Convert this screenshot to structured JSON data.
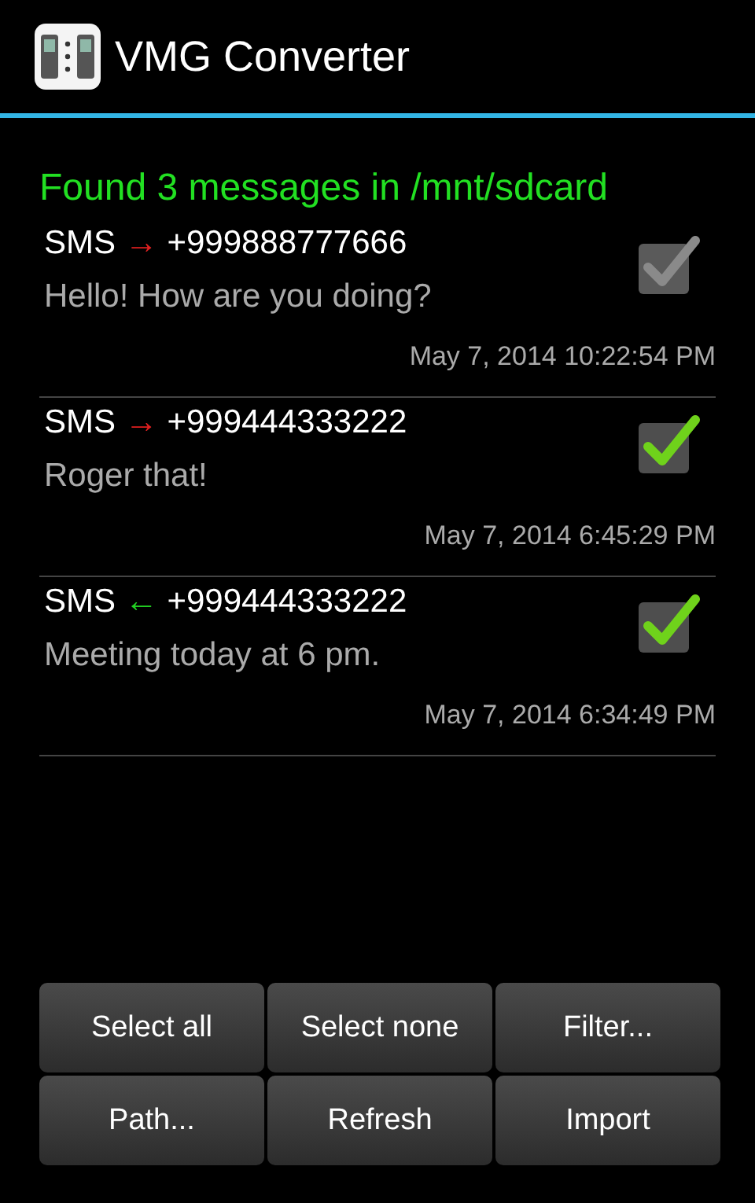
{
  "app_bar": {
    "title": "VMG Converter"
  },
  "status": "Found 3 messages in /mnt/sdcard",
  "messages": [
    {
      "type": "SMS",
      "color": "#e02020",
      "arrow": "→",
      "number": "+999888777666",
      "text": "Hello! How are you doing?",
      "date": "May 7, 2014 10:22:54 PM",
      "checked": false
    },
    {
      "type": "SMS",
      "color": "#e02020",
      "arrow": "→",
      "number": "+999444333222",
      "text": "Roger that!",
      "date": "May 7, 2014 6:45:29 PM",
      "checked": true
    },
    {
      "type": "SMS",
      "color": "#22d022",
      "arrow": "←",
      "number": "+999444333222",
      "text": "Meeting today at 6 pm.",
      "date": "May 7, 2014 6:34:49 PM",
      "checked": true
    }
  ],
  "buttons": [
    "Select all",
    "Select none",
    "Filter...",
    "Path...",
    "Refresh",
    "Import"
  ]
}
